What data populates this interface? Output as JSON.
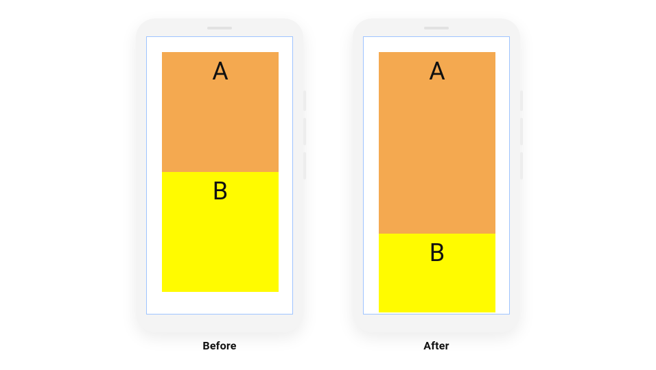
{
  "colors": {
    "boxA": "#f4a950",
    "boxB": "#fffb00",
    "screenBorder": "#9ec4ff",
    "phoneBody": "#f4f4f4"
  },
  "phones": {
    "before": {
      "caption": "Before",
      "boxA": {
        "label": "A",
        "heightPx": 175
      },
      "boxB": {
        "label": "B",
        "heightPx": 175
      }
    },
    "after": {
      "caption": "After",
      "boxA": {
        "label": "A",
        "heightPx": 265
      },
      "boxB": {
        "label": "B",
        "heightPx": 115
      }
    }
  }
}
